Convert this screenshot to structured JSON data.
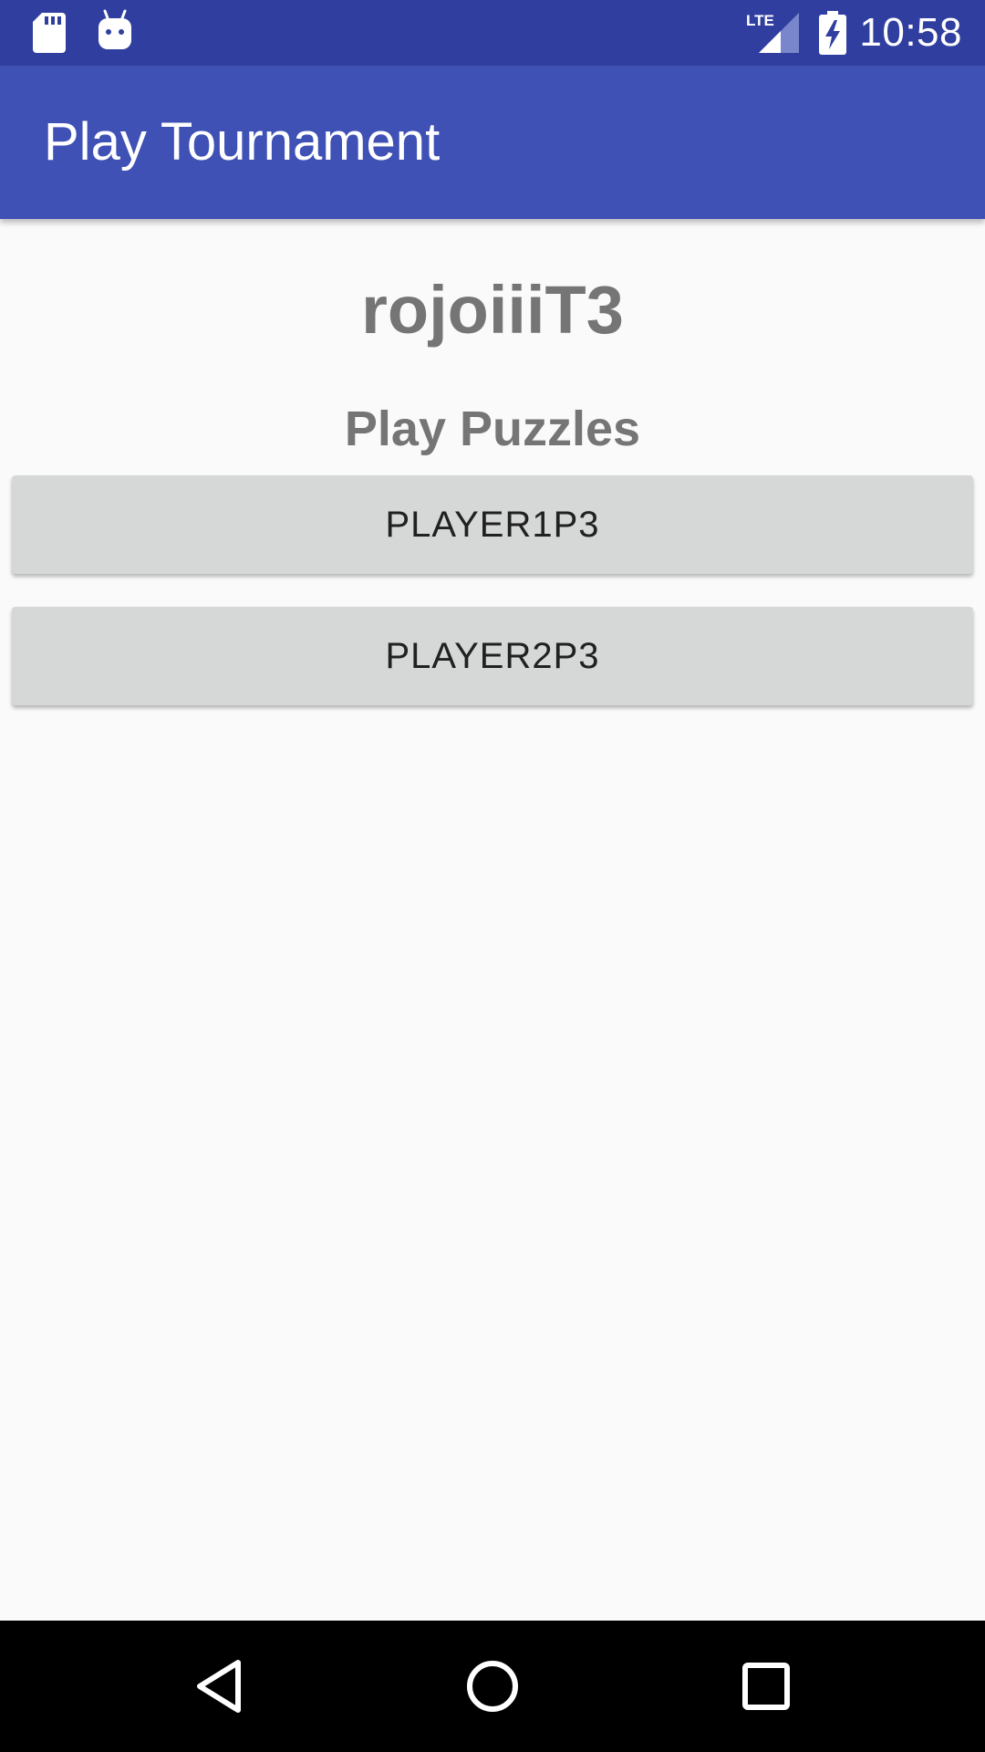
{
  "status_bar": {
    "time": "10:58",
    "network_label": "LTE",
    "background_color": "#303f9f",
    "icons": [
      "sd-card-icon",
      "android-icon",
      "lte-signal-icon",
      "battery-charging-icon"
    ]
  },
  "app_bar": {
    "title": "Play Tournament",
    "background_color": "#3f51b5"
  },
  "main": {
    "tournament_name": "rojoiiiT3",
    "section_heading": "Play Puzzles",
    "buttons": [
      {
        "label": "PLAYER1P3"
      },
      {
        "label": "PLAYER2P3"
      }
    ]
  },
  "nav_bar": {
    "icons": [
      "back-icon",
      "home-icon",
      "recents-icon"
    ]
  }
}
